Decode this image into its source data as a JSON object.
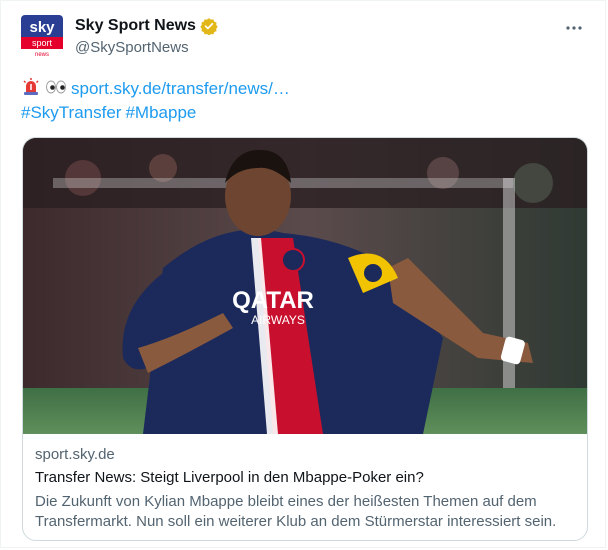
{
  "author": {
    "display_name": "Sky Sport News",
    "handle": "@SkySportNews",
    "avatar_line1": "sky",
    "avatar_line2": "sport",
    "avatar_line3": "news"
  },
  "tweet": {
    "emojis": [
      "rotating-light",
      "eyes"
    ],
    "link_text": "sport.sky.de/transfer/news/…",
    "hashtags": [
      "#SkyTransfer",
      "#Mbappe"
    ]
  },
  "card": {
    "domain": "sport.sky.de",
    "title": "Transfer News: Steigt Liverpool in den Mbappe-Poker ein?",
    "description": "Die Zukunft von Kylian Mbappe bleibt eines der heißesten Themen auf dem Transfermarkt. Nun soll ein weiterer Klub an dem Stürmerstar interessiert sein."
  },
  "image_lettering": {
    "sponsor": "QATAR",
    "sponsor_sub": "AIRWAYS"
  },
  "colors": {
    "accent": "#1d9bf0",
    "verified": "#e2b719",
    "sky_red": "#e4002b",
    "psg_navy": "#1b2a5a"
  }
}
